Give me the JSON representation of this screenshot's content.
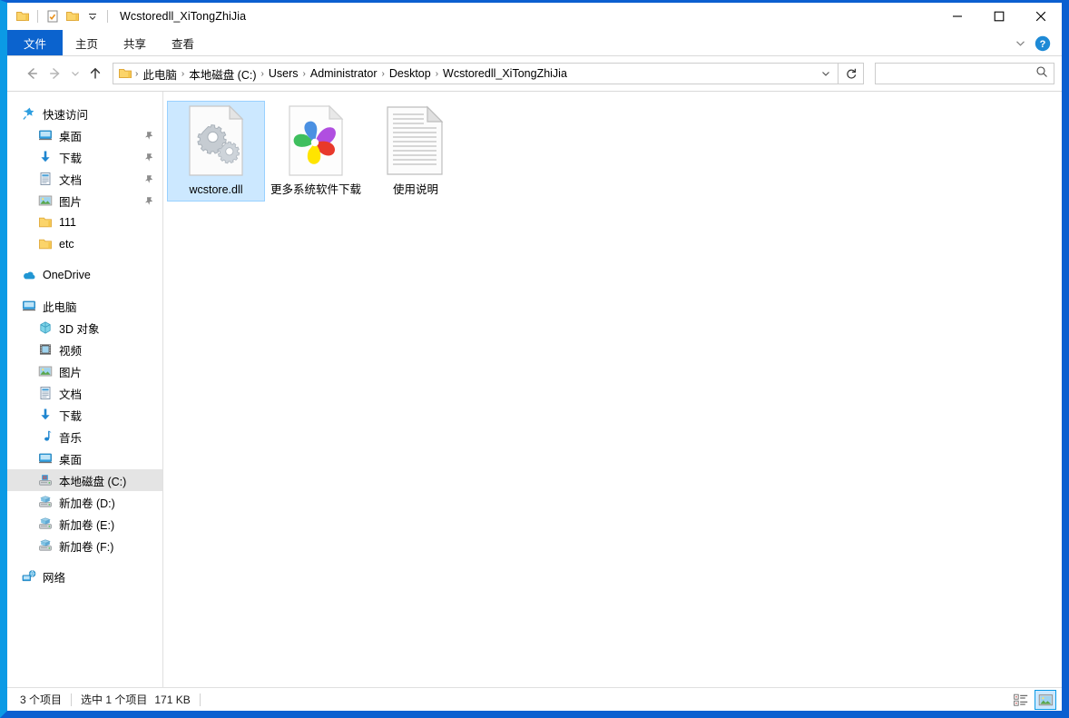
{
  "window": {
    "title": "Wcstoredll_XiTongZhiJia",
    "accent_left": "#0b9ae5",
    "accent_frame": "#0b5fd0",
    "selection_blue": "#cce8ff"
  },
  "quick_access_toolbar": {
    "app_icon": "folder-icon",
    "buttons": [
      {
        "name": "properties-icon",
        "label": "属性"
      },
      {
        "name": "new-folder-icon",
        "label": "新建文件夹"
      },
      {
        "name": "customize-qat-chevron-icon",
        "label": "自定义快速访问工具栏"
      }
    ]
  },
  "window_controls": {
    "minimize": "最小化",
    "maximize": "最大化",
    "close": "关闭"
  },
  "ribbon": {
    "tabs": [
      {
        "label": "文件",
        "active": true
      },
      {
        "label": "主页",
        "active": false
      },
      {
        "label": "共享",
        "active": false
      },
      {
        "label": "查看",
        "active": false
      }
    ],
    "collapse_label": "展开功能区",
    "help_label": "帮助"
  },
  "navigation": {
    "back_label": "后退",
    "forward_label": "前进",
    "recent_label": "最近浏览的位置",
    "up_label": "上移一级",
    "refresh_label": "刷新",
    "address_dropdown_label": "以前的位置"
  },
  "breadcrumb": {
    "items": [
      "此电脑",
      "本地磁盘 (C:)",
      "Users",
      "Administrator",
      "Desktop",
      "Wcstoredll_XiTongZhiJia"
    ],
    "separator": "›"
  },
  "search": {
    "value": "",
    "placeholder": "",
    "icon": "search-icon"
  },
  "sidebar": {
    "groups": [
      {
        "header": {
          "label": "快速访问",
          "icon": "star-pin-icon"
        },
        "items": [
          {
            "label": "桌面",
            "icon": "desktop-icon",
            "pinned": true
          },
          {
            "label": "下载",
            "icon": "download-icon",
            "pinned": true
          },
          {
            "label": "文档",
            "icon": "documents-icon",
            "pinned": true
          },
          {
            "label": "图片",
            "icon": "pictures-icon",
            "pinned": true
          },
          {
            "label": "111",
            "icon": "folder-icon",
            "pinned": false
          },
          {
            "label": "etc",
            "icon": "folder-icon",
            "pinned": false
          }
        ]
      },
      {
        "header": {
          "label": "OneDrive",
          "icon": "onedrive-cloud-icon"
        },
        "items": []
      },
      {
        "header": {
          "label": "此电脑",
          "icon": "this-pc-icon"
        },
        "items": [
          {
            "label": "3D 对象",
            "icon": "3d-objects-icon",
            "pinned": false
          },
          {
            "label": "视频",
            "icon": "videos-icon",
            "pinned": false
          },
          {
            "label": "图片",
            "icon": "pictures-icon",
            "pinned": false
          },
          {
            "label": "文档",
            "icon": "documents-icon",
            "pinned": false
          },
          {
            "label": "下载",
            "icon": "download-icon",
            "pinned": false
          },
          {
            "label": "音乐",
            "icon": "music-icon",
            "pinned": false
          },
          {
            "label": "桌面",
            "icon": "desktop-icon",
            "pinned": false
          },
          {
            "label": "本地磁盘 (C:)",
            "icon": "system-drive-icon",
            "pinned": false,
            "selected": true
          },
          {
            "label": "新加卷 (D:)",
            "icon": "drive-icon",
            "pinned": false
          },
          {
            "label": "新加卷 (E:)",
            "icon": "drive-icon",
            "pinned": false
          },
          {
            "label": "新加卷 (F:)",
            "icon": "drive-icon",
            "pinned": false
          }
        ]
      },
      {
        "header": {
          "label": "网络",
          "icon": "network-icon"
        },
        "items": []
      }
    ]
  },
  "files": [
    {
      "name": "wcstore.dll",
      "icon": "dll-gears-icon",
      "selected": true
    },
    {
      "name": "更多系统软件下载",
      "icon": "pinwheel-shortcut-icon",
      "selected": false
    },
    {
      "name": "使用说明",
      "icon": "text-document-icon",
      "selected": false
    }
  ],
  "status_bar": {
    "item_count": "3 个项目",
    "selection": "选中 1 个项目",
    "size": "171 KB",
    "views": [
      {
        "name": "details-view",
        "label": "详细信息",
        "active": false
      },
      {
        "name": "large-icons-view",
        "label": "大图标",
        "active": true
      }
    ]
  }
}
